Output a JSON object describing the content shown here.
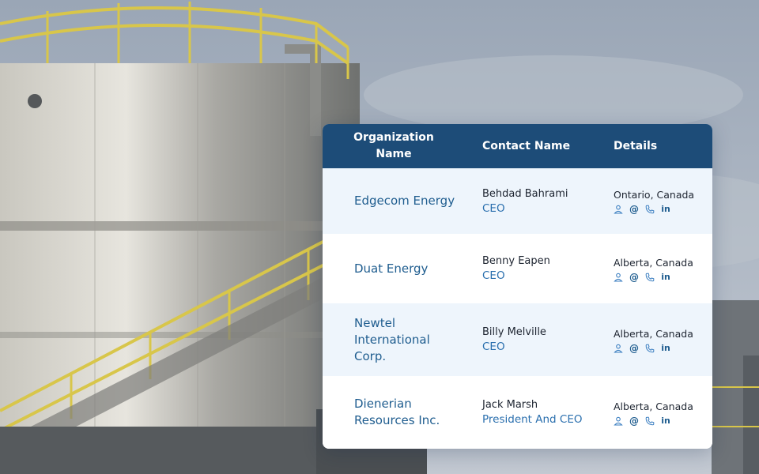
{
  "table": {
    "headers": {
      "organization": "Organization Name",
      "contact": "Contact Name",
      "details": "Details"
    },
    "rows": [
      {
        "organization": "Edgecom Energy",
        "contact_name": "Behdad Bahrami",
        "contact_title": "CEO",
        "location": "Ontario, Canada",
        "icons": [
          "person-icon",
          "email-icon",
          "phone-icon",
          "linkedin-icon"
        ]
      },
      {
        "organization": "Duat Energy",
        "contact_name": "Benny Eapen",
        "contact_title": "CEO",
        "location": "Alberta, Canada",
        "icons": [
          "person-icon",
          "email-icon",
          "phone-icon",
          "linkedin-icon"
        ]
      },
      {
        "organization": "Newtel International Corp.",
        "contact_name": "Billy Melville",
        "contact_title": "CEO",
        "location": "Alberta, Canada",
        "icons": [
          "person-icon",
          "email-icon",
          "phone-icon",
          "linkedin-icon"
        ]
      },
      {
        "organization": "Dienerian Resources Inc.",
        "contact_name": "Jack Marsh",
        "contact_title": "President And CEO",
        "location": "Alberta, Canada",
        "icons": [
          "person-icon",
          "email-icon",
          "phone-icon",
          "linkedin-icon"
        ]
      }
    ]
  },
  "icon_glyphs": {
    "email": "@",
    "linkedin": "in"
  },
  "colors": {
    "header_bg": "#1d4c78",
    "header_text": "#ffffff",
    "org_text": "#1f5d8f",
    "title_text": "#2a6fae",
    "row_alt_bg": "#eef5fc",
    "icon": "#3c7fc1"
  }
}
